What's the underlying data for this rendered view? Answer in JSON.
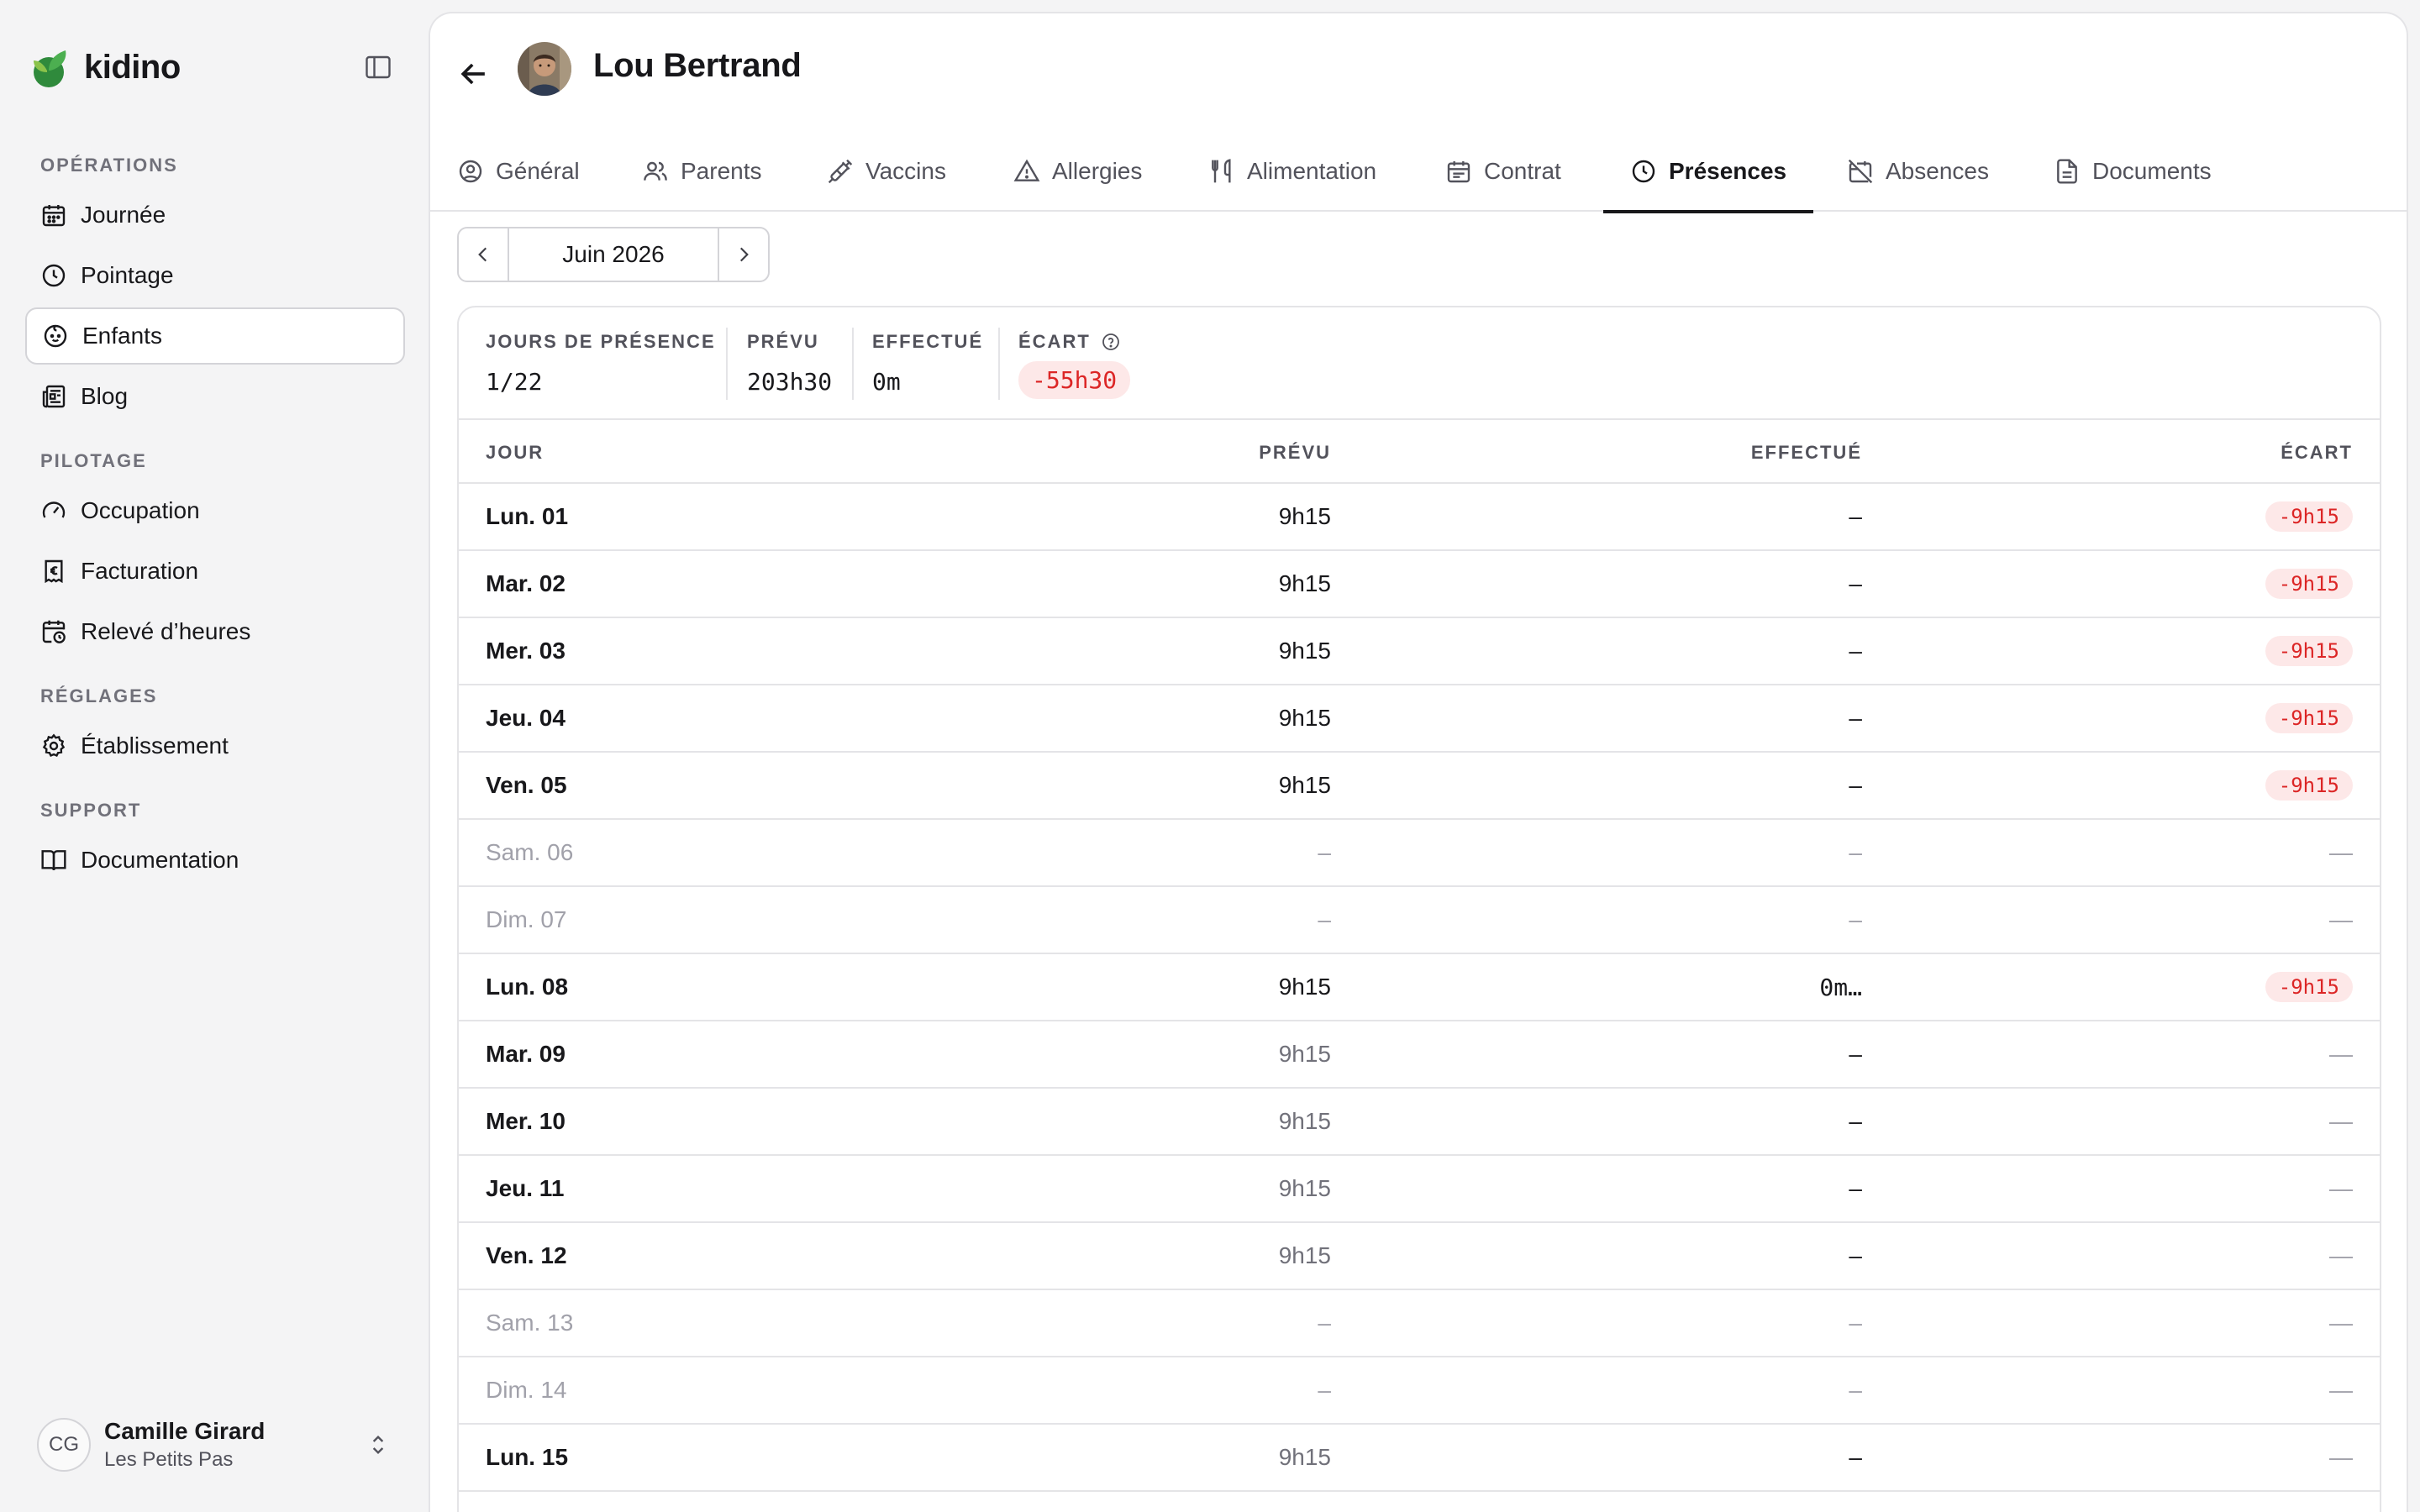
{
  "brand": {
    "name": "kidino"
  },
  "sidebar": {
    "sections": [
      {
        "title": "OPÉRATIONS",
        "items": [
          {
            "label": "Journée",
            "icon": "calendar-icon"
          },
          {
            "label": "Pointage",
            "icon": "clock-icon"
          },
          {
            "label": "Enfants",
            "icon": "baby-icon",
            "active": true
          },
          {
            "label": "Blog",
            "icon": "newspaper-icon"
          }
        ]
      },
      {
        "title": "PILOTAGE",
        "items": [
          {
            "label": "Occupation",
            "icon": "gauge-icon"
          },
          {
            "label": "Facturation",
            "icon": "euro-receipt-icon"
          },
          {
            "label": "Relevé d’heures",
            "icon": "calendar-clock-icon"
          }
        ]
      },
      {
        "title": "RÉGLAGES",
        "items": [
          {
            "label": "Établissement",
            "icon": "gear-icon"
          }
        ]
      },
      {
        "title": "SUPPORT",
        "items": [
          {
            "label": "Documentation",
            "icon": "book-icon"
          }
        ]
      }
    ]
  },
  "user": {
    "initials": "CG",
    "name": "Camille Girard",
    "organization": "Les Petits Pas"
  },
  "header": {
    "title": "Lou Bertrand"
  },
  "tabs": [
    {
      "label": "Général",
      "icon": "user-circle-icon"
    },
    {
      "label": "Parents",
      "icon": "users-icon"
    },
    {
      "label": "Vaccins",
      "icon": "syringe-icon"
    },
    {
      "label": "Allergies",
      "icon": "warning-icon"
    },
    {
      "label": "Alimentation",
      "icon": "utensils-icon"
    },
    {
      "label": "Contrat",
      "icon": "calendar-icon"
    },
    {
      "label": "Présences",
      "icon": "clock-icon",
      "active": true
    },
    {
      "label": "Absences",
      "icon": "calendar-off-icon"
    },
    {
      "label": "Documents",
      "icon": "file-icon"
    }
  ],
  "month_nav": {
    "label": "Juin 2026"
  },
  "stats": {
    "jours": {
      "label": "JOURS DE PRÉSENCE",
      "value": "1/22"
    },
    "prevu": {
      "label": "PRÉVU",
      "value": "203h30"
    },
    "effectue": {
      "label": "EFFECTUÉ",
      "value": "0m"
    },
    "ecart": {
      "label": "ÉCART",
      "value": "-55h30"
    }
  },
  "table": {
    "headers": {
      "jour": "JOUR",
      "prevu": "PRÉVU",
      "effectue": "EFFECTUÉ",
      "ecart": "ÉCART"
    },
    "rows": [
      {
        "day": "Lun. 01",
        "prevu": "9h15",
        "effectue": "–",
        "ecart": "-9h15",
        "weekend": false,
        "past": true
      },
      {
        "day": "Mar. 02",
        "prevu": "9h15",
        "effectue": "–",
        "ecart": "-9h15",
        "weekend": false,
        "past": true
      },
      {
        "day": "Mer. 03",
        "prevu": "9h15",
        "effectue": "–",
        "ecart": "-9h15",
        "weekend": false,
        "past": true
      },
      {
        "day": "Jeu. 04",
        "prevu": "9h15",
        "effectue": "–",
        "ecart": "-9h15",
        "weekend": false,
        "past": true
      },
      {
        "day": "Ven. 05",
        "prevu": "9h15",
        "effectue": "–",
        "ecart": "-9h15",
        "weekend": false,
        "past": true
      },
      {
        "day": "Sam. 06",
        "prevu": "–",
        "effectue": "–",
        "ecart": "—",
        "weekend": true,
        "past": true
      },
      {
        "day": "Dim. 07",
        "prevu": "–",
        "effectue": "–",
        "ecart": "—",
        "weekend": true,
        "past": true
      },
      {
        "day": "Lun. 08",
        "prevu": "9h15",
        "effectue": "0m…",
        "ecart": "-9h15",
        "weekend": false,
        "past": true
      },
      {
        "day": "Mar. 09",
        "prevu": "9h15",
        "effectue": "–",
        "ecart": "—",
        "weekend": false,
        "past": false
      },
      {
        "day": "Mer. 10",
        "prevu": "9h15",
        "effectue": "–",
        "ecart": "—",
        "weekend": false,
        "past": false
      },
      {
        "day": "Jeu. 11",
        "prevu": "9h15",
        "effectue": "–",
        "ecart": "—",
        "weekend": false,
        "past": false
      },
      {
        "day": "Ven. 12",
        "prevu": "9h15",
        "effectue": "–",
        "ecart": "—",
        "weekend": false,
        "past": false
      },
      {
        "day": "Sam. 13",
        "prevu": "–",
        "effectue": "–",
        "ecart": "—",
        "weekend": true,
        "past": false
      },
      {
        "day": "Dim. 14",
        "prevu": "–",
        "effectue": "–",
        "ecart": "—",
        "weekend": true,
        "past": false
      },
      {
        "day": "Lun. 15",
        "prevu": "9h15",
        "effectue": "–",
        "ecart": "—",
        "weekend": false,
        "past": false
      },
      {
        "day": "",
        "prevu": "",
        "effectue": "",
        "ecart": "",
        "weekend": false,
        "past": false
      }
    ]
  },
  "colors": {
    "accent": "#18181b",
    "negative": "#dc2626",
    "negative_bg": "#fde8e8",
    "brand_green": "#2f8a3c"
  }
}
